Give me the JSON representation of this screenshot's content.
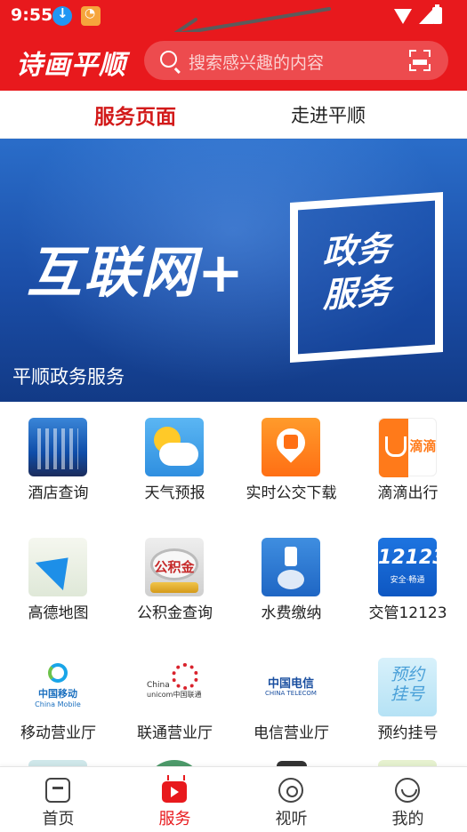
{
  "status_bar": {
    "time": "9:55"
  },
  "header": {
    "logo_text": "诗画平顺",
    "search_placeholder": "搜索感兴趣的内容"
  },
  "tabs": [
    {
      "label": "服务页面",
      "active": true
    },
    {
      "label": "走进平顺",
      "active": false
    }
  ],
  "banner": {
    "main_text": "互联网+",
    "box_text": "政务服务",
    "caption": "平顺政务服务"
  },
  "services": [
    {
      "label": "酒店查询",
      "icon": "hotel-icon"
    },
    {
      "label": "天气预报",
      "icon": "weather-icon"
    },
    {
      "label": "实时公交下载",
      "icon": "bus-icon"
    },
    {
      "label": "滴滴出行",
      "icon": "didi-icon",
      "icon_text": "滴滴"
    },
    {
      "label": "高德地图",
      "icon": "gaode-map-icon"
    },
    {
      "label": "公积金查询",
      "icon": "housing-fund-icon",
      "icon_text": "公积金"
    },
    {
      "label": "水费缴纳",
      "icon": "water-fee-icon"
    },
    {
      "label": "交管12123",
      "icon": "traffic-12123-icon",
      "icon_text": "12123",
      "icon_subtext": "安全·畅通"
    },
    {
      "label": "移动营业厅",
      "icon": "china-mobile-icon",
      "icon_text": "中国移动",
      "icon_subtext": "China Mobile"
    },
    {
      "label": "联通营业厅",
      "icon": "china-unicom-icon",
      "icon_text": "China",
      "icon_subtext": "unicom中国联通"
    },
    {
      "label": "电信营业厅",
      "icon": "china-telecom-icon",
      "icon_text": "中国电信",
      "icon_subtext": "CHINA TELECOM"
    },
    {
      "label": "预约挂号",
      "icon": "appointment-icon",
      "icon_text": "预约挂号"
    }
  ],
  "bottom_nav": [
    {
      "label": "首页",
      "icon": "home-icon",
      "active": false
    },
    {
      "label": "服务",
      "icon": "tv-play-icon",
      "active": true
    },
    {
      "label": "视听",
      "icon": "listen-icon",
      "active": false
    },
    {
      "label": "我的",
      "icon": "smile-profile-icon",
      "active": false
    }
  ],
  "colors": {
    "brand_red": "#e8191d",
    "banner_blue": "#1b4ea8",
    "text_dark": "#222222"
  }
}
